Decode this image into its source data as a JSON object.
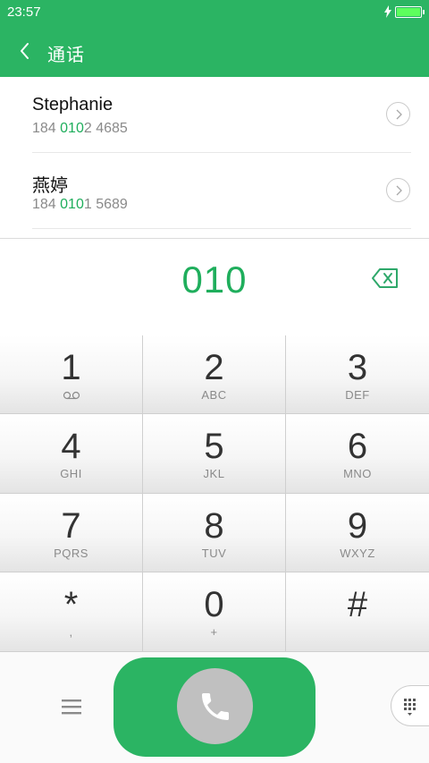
{
  "status": {
    "time": "23:57",
    "battery_level": 1.0
  },
  "header": {
    "title": "通话",
    "back_icon": "chevron-left-icon"
  },
  "contacts": [
    {
      "name": "Stephanie",
      "number_prefix": "184 ",
      "number_match": "010",
      "number_suffix": "2 4685"
    },
    {
      "name": "燕婷",
      "number_prefix": "184 ",
      "number_match": "010",
      "number_suffix": "1 5689"
    }
  ],
  "dialed": "010",
  "keys": [
    {
      "digit": "1",
      "letters": ""
    },
    {
      "digit": "2",
      "letters": "ABC"
    },
    {
      "digit": "3",
      "letters": "DEF"
    },
    {
      "digit": "4",
      "letters": "GHI"
    },
    {
      "digit": "5",
      "letters": "JKL"
    },
    {
      "digit": "6",
      "letters": "MNO"
    },
    {
      "digit": "7",
      "letters": "PQRS"
    },
    {
      "digit": "8",
      "letters": "TUV"
    },
    {
      "digit": "9",
      "letters": "WXYZ"
    },
    {
      "digit": "*",
      "letters": ","
    },
    {
      "digit": "0",
      "letters": "+"
    },
    {
      "digit": "#",
      "letters": ""
    }
  ],
  "colors": {
    "accent": "#2bb463",
    "match": "#1fae5c",
    "call_circle": "#c0c0c0"
  }
}
